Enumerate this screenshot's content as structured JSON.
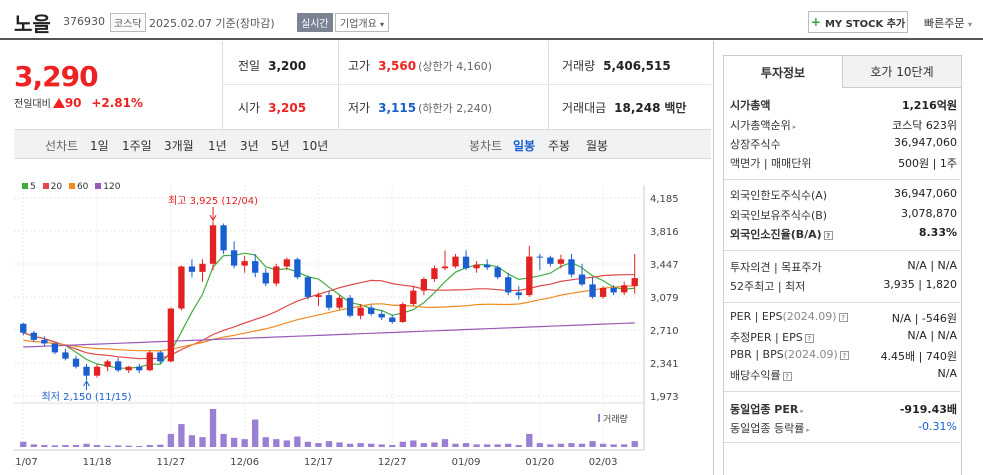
{
  "header": {
    "name": "노을",
    "code": "376930",
    "market": "코스닥",
    "date_text": "2025.02.07  기준(장마감)",
    "realtime": "실시간",
    "company_info": "기업개요",
    "mystock": "MY STOCK 추가",
    "quick_order": "빠른주문"
  },
  "price": {
    "current": "3,290",
    "change_label": "전일대비",
    "change": "90",
    "change_pct": "+2.81%"
  },
  "stats": {
    "prev_label": "전일",
    "prev": "3,200",
    "open_label": "시가",
    "open": "3,205",
    "high_label": "고가",
    "high": "3,560",
    "upper_limit": "(상한가 4,160)",
    "low_label": "저가",
    "low": "3,115",
    "lower_limit": "(하한가 2,240)",
    "volume_label": "거래량",
    "volume": "5,406,515",
    "amount_label": "거래대금",
    "amount": "18,248",
    "amount_unit": "백만"
  },
  "period_bar": {
    "line_label": "선차트",
    "line_periods": [
      "1일",
      "1주일",
      "3개월",
      "1년",
      "3년",
      "5년",
      "10년"
    ],
    "candle_label": "봉차트",
    "candle_periods": [
      "일봉",
      "주봉",
      "월봉"
    ],
    "selected_candle": "일봉"
  },
  "colors": {
    "up": "#e22222",
    "down": "#1a5fd0",
    "ma5": "#3fae3f",
    "ma20": "#e24848",
    "ma60": "#f08a1e",
    "ma120": "#9b59b6",
    "volume": "#9b7fd4"
  },
  "chart_data": {
    "type": "candlestick",
    "legend": [
      "5",
      "20",
      "60",
      "120"
    ],
    "y_ticks": [
      "4,185",
      "3,816",
      "3,447",
      "3,079",
      "2,710",
      "2,341",
      "1,973"
    ],
    "ylim": [
      1973,
      4185
    ],
    "x_ticks": [
      {
        "label": "11/07",
        "i": 0
      },
      {
        "label": "11/18",
        "i": 7
      },
      {
        "label": "11/27",
        "i": 14
      },
      {
        "label": "12/06",
        "i": 21
      },
      {
        "label": "12/17",
        "i": 28
      },
      {
        "label": "12/27",
        "i": 35
      },
      {
        "label": "01/09",
        "i": 42
      },
      {
        "label": "01/20",
        "i": 49
      },
      {
        "label": "02/03",
        "i": 55
      }
    ],
    "high_annotation": "최고 3,925 (12/04)",
    "low_annotation": "최저 2,150 (11/15)",
    "volume_label": "거래량",
    "candles": [
      [
        2780,
        2790,
        2650,
        2680
      ],
      [
        2680,
        2700,
        2580,
        2600
      ],
      [
        2600,
        2640,
        2530,
        2560
      ],
      [
        2560,
        2560,
        2440,
        2460
      ],
      [
        2460,
        2500,
        2370,
        2390
      ],
      [
        2390,
        2420,
        2280,
        2300
      ],
      [
        2300,
        2330,
        2150,
        2200
      ],
      [
        2200,
        2330,
        2180,
        2300
      ],
      [
        2300,
        2380,
        2250,
        2360
      ],
      [
        2360,
        2400,
        2240,
        2260
      ],
      [
        2260,
        2310,
        2230,
        2300
      ],
      [
        2300,
        2330,
        2230,
        2260
      ],
      [
        2260,
        2480,
        2250,
        2460
      ],
      [
        2460,
        2480,
        2330,
        2360
      ],
      [
        2360,
        2960,
        2350,
        2950
      ],
      [
        2950,
        3430,
        2930,
        3420
      ],
      [
        3420,
        3500,
        3300,
        3360
      ],
      [
        3360,
        3500,
        3250,
        3450
      ],
      [
        3450,
        3925,
        3380,
        3880
      ],
      [
        3880,
        3900,
        3560,
        3600
      ],
      [
        3600,
        3700,
        3400,
        3430
      ],
      [
        3430,
        3540,
        3350,
        3480
      ],
      [
        3480,
        3560,
        3300,
        3350
      ],
      [
        3350,
        3400,
        3200,
        3230
      ],
      [
        3230,
        3450,
        3200,
        3420
      ],
      [
        3420,
        3520,
        3380,
        3500
      ],
      [
        3500,
        3520,
        3280,
        3300
      ],
      [
        3300,
        3320,
        3050,
        3080
      ],
      [
        3080,
        3130,
        2980,
        3100
      ],
      [
        3100,
        3150,
        2930,
        2960
      ],
      [
        2960,
        3100,
        2940,
        3070
      ],
      [
        3070,
        3100,
        2850,
        2870
      ],
      [
        2870,
        3000,
        2830,
        2960
      ],
      [
        2960,
        2990,
        2870,
        2890
      ],
      [
        2890,
        2930,
        2820,
        2850
      ],
      [
        2850,
        2880,
        2780,
        2800
      ],
      [
        2800,
        3020,
        2790,
        3000
      ],
      [
        3000,
        3200,
        2980,
        3150
      ],
      [
        3150,
        3300,
        3100,
        3280
      ],
      [
        3280,
        3430,
        3250,
        3400
      ],
      [
        3400,
        3600,
        3380,
        3420
      ],
      [
        3420,
        3560,
        3400,
        3530
      ],
      [
        3530,
        3600,
        3380,
        3400
      ],
      [
        3400,
        3480,
        3350,
        3440
      ],
      [
        3440,
        3500,
        3380,
        3410
      ],
      [
        3410,
        3430,
        3280,
        3300
      ],
      [
        3300,
        3350,
        3100,
        3130
      ],
      [
        3130,
        3200,
        3050,
        3100
      ],
      [
        3100,
        3650,
        3080,
        3530
      ],
      [
        3530,
        3560,
        3380,
        3520
      ],
      [
        3520,
        3540,
        3420,
        3450
      ],
      [
        3450,
        3550,
        3400,
        3500
      ],
      [
        3500,
        3560,
        3300,
        3330
      ],
      [
        3330,
        3450,
        3200,
        3220
      ],
      [
        3220,
        3300,
        3060,
        3080
      ],
      [
        3080,
        3200,
        3060,
        3180
      ],
      [
        3180,
        3210,
        3100,
        3130
      ],
      [
        3130,
        3250,
        3100,
        3210
      ],
      [
        3200,
        3560,
        3115,
        3290
      ]
    ],
    "volumes": [
      0.8,
      0.4,
      0.3,
      0.25,
      0.3,
      0.3,
      0.5,
      0.3,
      0.2,
      0.25,
      0.2,
      0.15,
      0.3,
      0.35,
      2.0,
      3.5,
      1.8,
      1.5,
      5.8,
      2.0,
      1.4,
      1.2,
      4.2,
      1.5,
      1.2,
      1.0,
      1.6,
      0.8,
      0.6,
      0.9,
      0.7,
      0.5,
      0.6,
      0.5,
      0.4,
      0.3,
      0.8,
      1.0,
      0.6,
      0.7,
      1.2,
      0.5,
      0.6,
      0.4,
      0.4,
      0.4,
      0.5,
      0.3,
      2.0,
      0.6,
      0.4,
      0.5,
      0.6,
      0.5,
      0.9,
      0.5,
      0.4,
      0.4,
      0.9
    ]
  },
  "side": {
    "tab_info": "투자정보",
    "tab_orderbook": "호가 10단계",
    "market_cap_label": "시가총액",
    "market_cap": "1,216억원",
    "cap_rank_label": "시가총액순위",
    "cap_rank": "코스닥 623위",
    "shares_label": "상장주식수",
    "shares": "36,947,060",
    "par_label": "액면가 | 매매단위",
    "par": "500원 | 1주",
    "foreign_limit_label": "외국인한도주식수(A)",
    "foreign_limit": "36,947,060",
    "foreign_hold_label": "외국인보유주식수(B)",
    "foreign_hold": "3,078,870",
    "foreign_ratio_label": "외국인소진율(B/A)",
    "foreign_ratio": "8.33%",
    "opinion_label": "투자의견 | 목표주가",
    "opinion": "N/A | N/A",
    "week52_label": "52주최고 | 최저",
    "week52": "3,935 | 1,820",
    "per_label": "PER | EPS",
    "per_date": "(2024.09)",
    "per": "N/A | -546원",
    "est_per_label": "추정PER | EPS",
    "est_per": "N/A | N/A",
    "pbr_label": "PBR | BPS",
    "pbr_date": "(2024.09)",
    "pbr": "4.45배 | 740원",
    "div_label": "배당수익률",
    "div": "N/A",
    "sector_per_label": "동일업종 PER",
    "sector_per": "-919.43배",
    "sector_change_label": "동일업종 등락률",
    "sector_change": "-0.31%"
  }
}
